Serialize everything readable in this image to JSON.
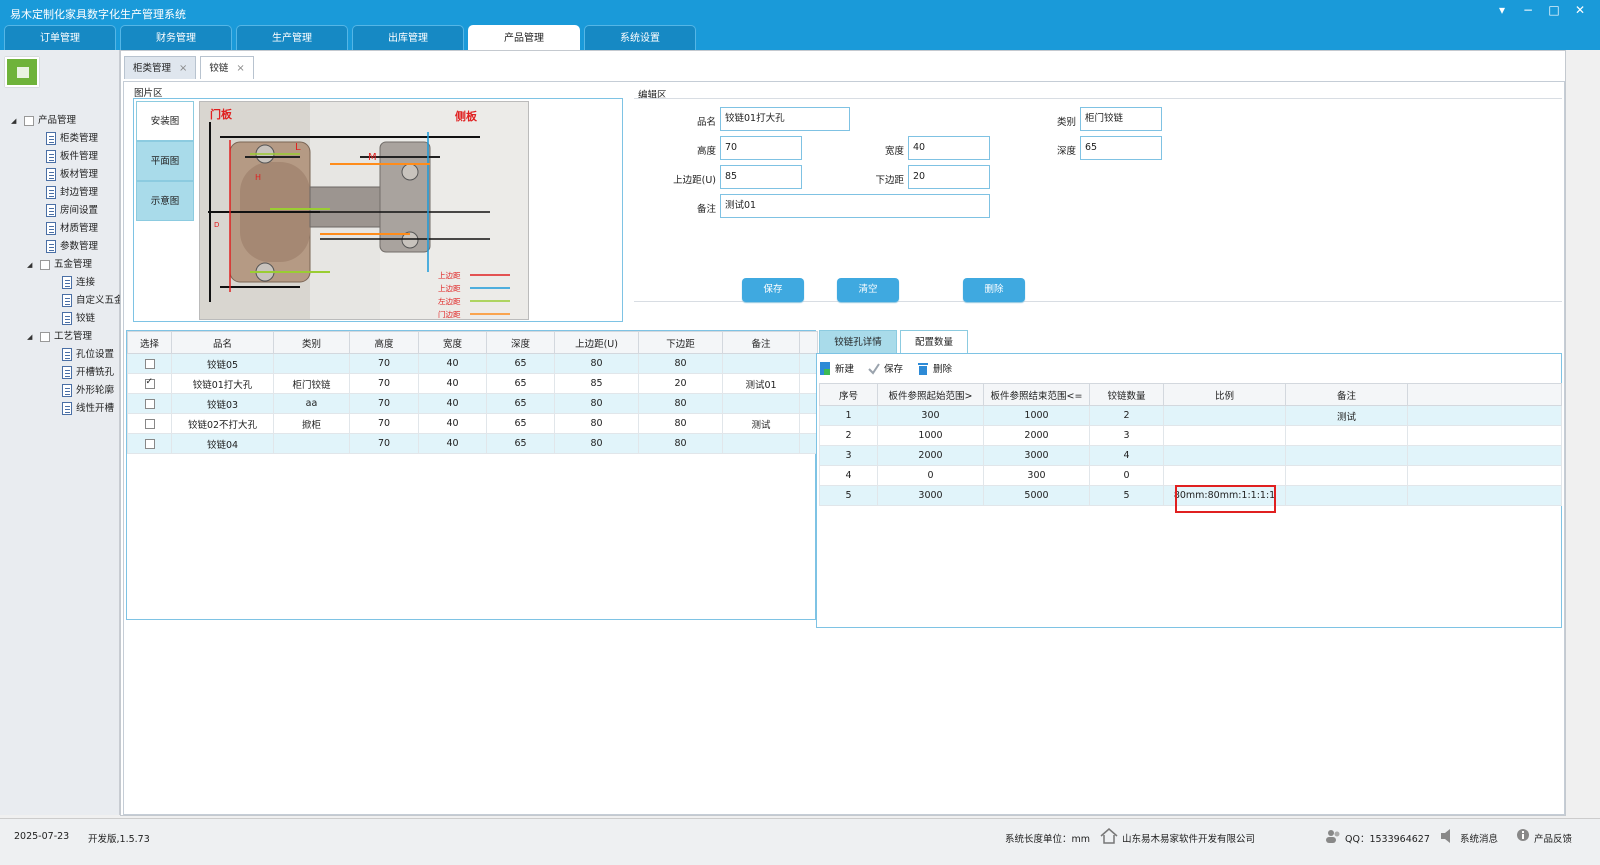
{
  "app": {
    "title": "易木定制化家具数字化生产管理系统"
  },
  "window_controls": {
    "menu": "▾",
    "minimize": "−",
    "maximize": "□",
    "close": "✕"
  },
  "main_tabs": [
    {
      "label": "订单管理",
      "active": false
    },
    {
      "label": "财务管理",
      "active": false
    },
    {
      "label": "生产管理",
      "active": false
    },
    {
      "label": "出库管理",
      "active": false
    },
    {
      "label": "产品管理",
      "active": true
    },
    {
      "label": "系统设置",
      "active": false
    }
  ],
  "tree": [
    {
      "label": "产品管理",
      "level": 0,
      "type": "folder"
    },
    {
      "label": "柜类管理",
      "level": 1,
      "type": "page"
    },
    {
      "label": "板件管理",
      "level": 1,
      "type": "page"
    },
    {
      "label": "板材管理",
      "level": 1,
      "type": "page"
    },
    {
      "label": "封边管理",
      "level": 1,
      "type": "page"
    },
    {
      "label": "房间设置",
      "level": 1,
      "type": "page"
    },
    {
      "label": "材质管理",
      "level": 1,
      "type": "page"
    },
    {
      "label": "参数管理",
      "level": 1,
      "type": "page"
    },
    {
      "label": "五金管理",
      "level": 1,
      "type": "folder"
    },
    {
      "label": "连接",
      "level": 2,
      "type": "page"
    },
    {
      "label": "自定义五金",
      "level": 2,
      "type": "page"
    },
    {
      "label": "铰链",
      "level": 2,
      "type": "page"
    },
    {
      "label": "工艺管理",
      "level": 1,
      "type": "folder"
    },
    {
      "label": "孔位设置",
      "level": 2,
      "type": "page"
    },
    {
      "label": "开槽铣孔",
      "level": 2,
      "type": "page"
    },
    {
      "label": "外形轮廓",
      "level": 2,
      "type": "page"
    },
    {
      "label": "线性开槽",
      "level": 2,
      "type": "page"
    }
  ],
  "sub_tabs": [
    {
      "label": "柜类管理",
      "close": "×"
    },
    {
      "label": "铰链",
      "close": "×"
    }
  ],
  "image_area": {
    "title": "图片区",
    "tabs": [
      "安装图",
      "平面图",
      "示意图"
    ],
    "photo_labels": {
      "door": "门板",
      "side": "侧板",
      "l": "L",
      "m": "M",
      "h": "H",
      "d": "D"
    },
    "legend": [
      "上边距",
      "上边距",
      "左边距",
      "门边距"
    ]
  },
  "edit_area": {
    "title": "编辑区",
    "fields": {
      "name_label": "品名",
      "name": "铰链01打大孔",
      "category_label": "类别",
      "category": "柜门铰链",
      "height_label": "高度",
      "height": "70",
      "width_label": "宽度",
      "width": "40",
      "depth_label": "深度",
      "depth": "65",
      "top_label": "上边距(U)",
      "top": "85",
      "bottom_label": "下边距",
      "bottom": "20",
      "note_label": "备注",
      "note": "测试01"
    },
    "buttons": {
      "save": "保存",
      "clear": "清空",
      "delete": "删除"
    }
  },
  "left_grid": {
    "headers": [
      "选择",
      "品名",
      "类别",
      "高度",
      "宽度",
      "深度",
      "上边距(U)",
      "下边距",
      "备注"
    ],
    "rows": [
      {
        "checked": false,
        "cells": [
          "铰链05",
          "",
          "70",
          "40",
          "65",
          "80",
          "80",
          ""
        ]
      },
      {
        "checked": true,
        "cells": [
          "铰链01打大孔",
          "柜门铰链",
          "70",
          "40",
          "65",
          "85",
          "20",
          "测试01"
        ]
      },
      {
        "checked": false,
        "cells": [
          "铰链03",
          "aa",
          "70",
          "40",
          "65",
          "80",
          "80",
          ""
        ]
      },
      {
        "checked": false,
        "cells": [
          "铰链02不打大孔",
          "掀柜",
          "70",
          "40",
          "65",
          "80",
          "80",
          "测试"
        ]
      },
      {
        "checked": false,
        "cells": [
          "铰链04",
          "",
          "70",
          "40",
          "65",
          "80",
          "80",
          ""
        ]
      }
    ]
  },
  "right_tabs": [
    {
      "label": "铰链孔详情",
      "active": false
    },
    {
      "label": "配置数量",
      "active": true
    }
  ],
  "right_toolbar": {
    "new": "新建",
    "save": "保存",
    "delete": "删除"
  },
  "right_grid": {
    "headers": [
      "序号",
      "板件参照起始范围>",
      "板件参照结束范围<=",
      "铰链数量",
      "比例",
      "备注"
    ],
    "rows": [
      [
        "1",
        "300",
        "1000",
        "2",
        "",
        "测试"
      ],
      [
        "2",
        "1000",
        "2000",
        "3",
        "",
        ""
      ],
      [
        "3",
        "2000",
        "3000",
        "4",
        "",
        ""
      ],
      [
        "4",
        "0",
        "300",
        "0",
        "",
        ""
      ],
      [
        "5",
        "3000",
        "5000",
        "5",
        "80mm:80mm:1:1:1:1",
        ""
      ]
    ]
  },
  "status": {
    "date": "2025-07-23",
    "version": "开发版,1.5.73",
    "unit": "系统长度单位：mm",
    "company": "山东易木易家软件开发有限公司",
    "qq": "QQ：1533964627",
    "messages": "系统消息",
    "feedback": "产品反馈"
  },
  "colors": {
    "titlebar": "#1a9ad9",
    "accent": "#3fa9e0",
    "row_highlight": "#e1f4fa",
    "tab_inactive": "#a9dbea",
    "highlight_box": "#e02020"
  }
}
